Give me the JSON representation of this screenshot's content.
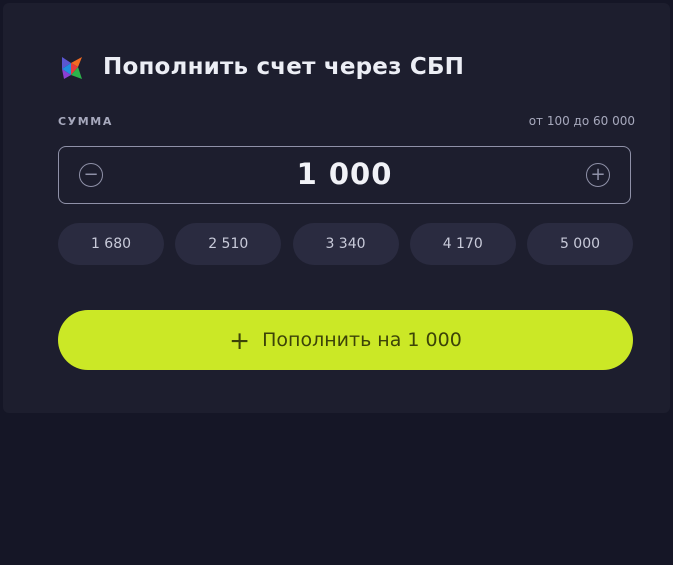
{
  "header": {
    "title": "Пополнить счет через СБП",
    "logo_icon": "sbp-logo-icon"
  },
  "amount": {
    "label": "СУММА",
    "range": "от 100 до 60 000",
    "value": "1 000",
    "minus_icon": "minus-circle-icon",
    "plus_icon": "plus-circle-icon"
  },
  "presets": [
    "1 680",
    "2 510",
    "3 340",
    "4 170",
    "5 000"
  ],
  "submit": {
    "icon": "plus-icon",
    "label": "Пополнить на 1 000"
  },
  "colors": {
    "background": "#151626",
    "card": "#1d1e2e",
    "accent": "#cbe826",
    "preset_bg": "#2a2b40"
  }
}
